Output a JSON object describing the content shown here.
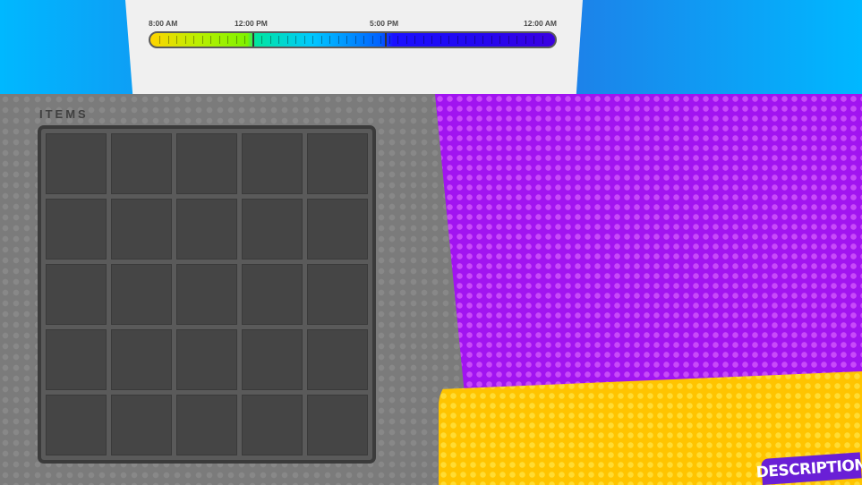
{
  "time_bar": {
    "labels": [
      "8:00 AM",
      "12:00 PM",
      "5:00 PM",
      "12:00 AM"
    ]
  },
  "items_panel": {
    "title": "ITEMS",
    "rows": 5,
    "columns": 5
  },
  "description_tab": {
    "label": "DESCRIPTION"
  },
  "colors": {
    "gray_panel": "#7b7b7b",
    "purple_panel": "#a114f0",
    "yellow_panel": "#ffc400",
    "badge": "#6a1fd6"
  }
}
